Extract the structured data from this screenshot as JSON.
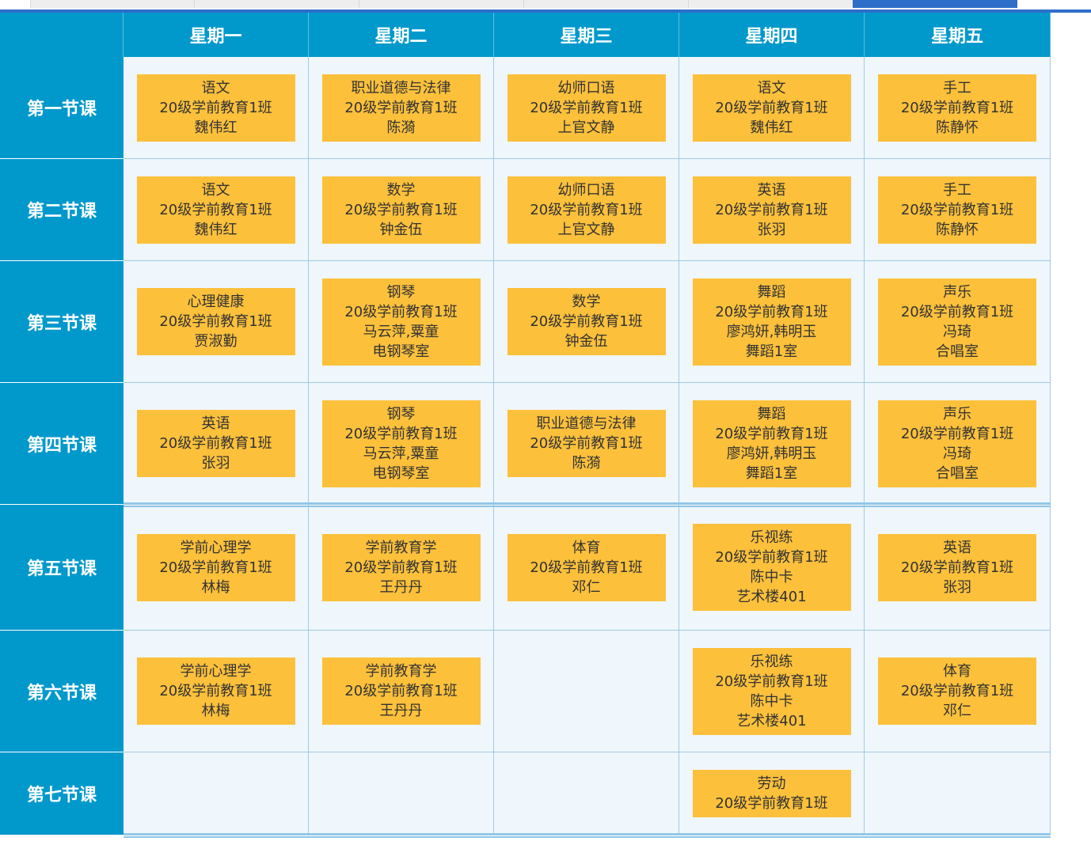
{
  "colors": {
    "header_bg": "#0199cc",
    "cell_bg": "#eff6fc",
    "card_bg": "#fcc03b",
    "tab_active": "#2e6ec9"
  },
  "days": [
    "星期一",
    "星期二",
    "星期三",
    "星期四",
    "星期五"
  ],
  "periods": [
    "第一节课",
    "第二节课",
    "第三节课",
    "第四节课",
    "第五节课",
    "第六节课",
    "第七节课"
  ],
  "schedule": [
    [
      [
        "语文",
        "20级学前教育1班",
        "魏伟红"
      ],
      [
        "职业道德与法律",
        "20级学前教育1班",
        "陈漪"
      ],
      [
        "幼师口语",
        "20级学前教育1班",
        "上官文静"
      ],
      [
        "语文",
        "20级学前教育1班",
        "魏伟红"
      ],
      [
        "手工",
        "20级学前教育1班",
        "陈静怀"
      ]
    ],
    [
      [
        "语文",
        "20级学前教育1班",
        "魏伟红"
      ],
      [
        "数学",
        "20级学前教育1班",
        "钟金伍"
      ],
      [
        "幼师口语",
        "20级学前教育1班",
        "上官文静"
      ],
      [
        "英语",
        "20级学前教育1班",
        "张羽"
      ],
      [
        "手工",
        "20级学前教育1班",
        "陈静怀"
      ]
    ],
    [
      [
        "心理健康",
        "20级学前教育1班",
        "贾淑勤"
      ],
      [
        "钢琴",
        "20级学前教育1班",
        "马云萍,粟童",
        "电钢琴室"
      ],
      [
        "数学",
        "20级学前教育1班",
        "钟金伍"
      ],
      [
        "舞蹈",
        "20级学前教育1班",
        "廖鸿妍,韩明玉",
        "舞蹈1室"
      ],
      [
        "声乐",
        "20级学前教育1班",
        "冯琦",
        "合唱室"
      ]
    ],
    [
      [
        "英语",
        "20级学前教育1班",
        "张羽"
      ],
      [
        "钢琴",
        "20级学前教育1班",
        "马云萍,粟童",
        "电钢琴室"
      ],
      [
        "职业道德与法律",
        "20级学前教育1班",
        "陈漪"
      ],
      [
        "舞蹈",
        "20级学前教育1班",
        "廖鸿妍,韩明玉",
        "舞蹈1室"
      ],
      [
        "声乐",
        "20级学前教育1班",
        "冯琦",
        "合唱室"
      ]
    ],
    [
      [
        "学前心理学",
        "20级学前教育1班",
        "林梅"
      ],
      [
        "学前教育学",
        "20级学前教育1班",
        "王丹丹"
      ],
      [
        "体育",
        "20级学前教育1班",
        "邓仁"
      ],
      [
        "乐视练",
        "20级学前教育1班",
        "陈中卡",
        "艺术楼401"
      ],
      [
        "英语",
        "20级学前教育1班",
        "张羽"
      ]
    ],
    [
      [
        "学前心理学",
        "20级学前教育1班",
        "林梅"
      ],
      [
        "学前教育学",
        "20级学前教育1班",
        "王丹丹"
      ],
      [],
      [
        "乐视练",
        "20级学前教育1班",
        "陈中卡",
        "艺术楼401"
      ],
      [
        "体育",
        "20级学前教育1班",
        "邓仁"
      ]
    ],
    [
      [],
      [],
      [],
      [
        "劳动",
        "20级学前教育1班"
      ],
      []
    ]
  ]
}
